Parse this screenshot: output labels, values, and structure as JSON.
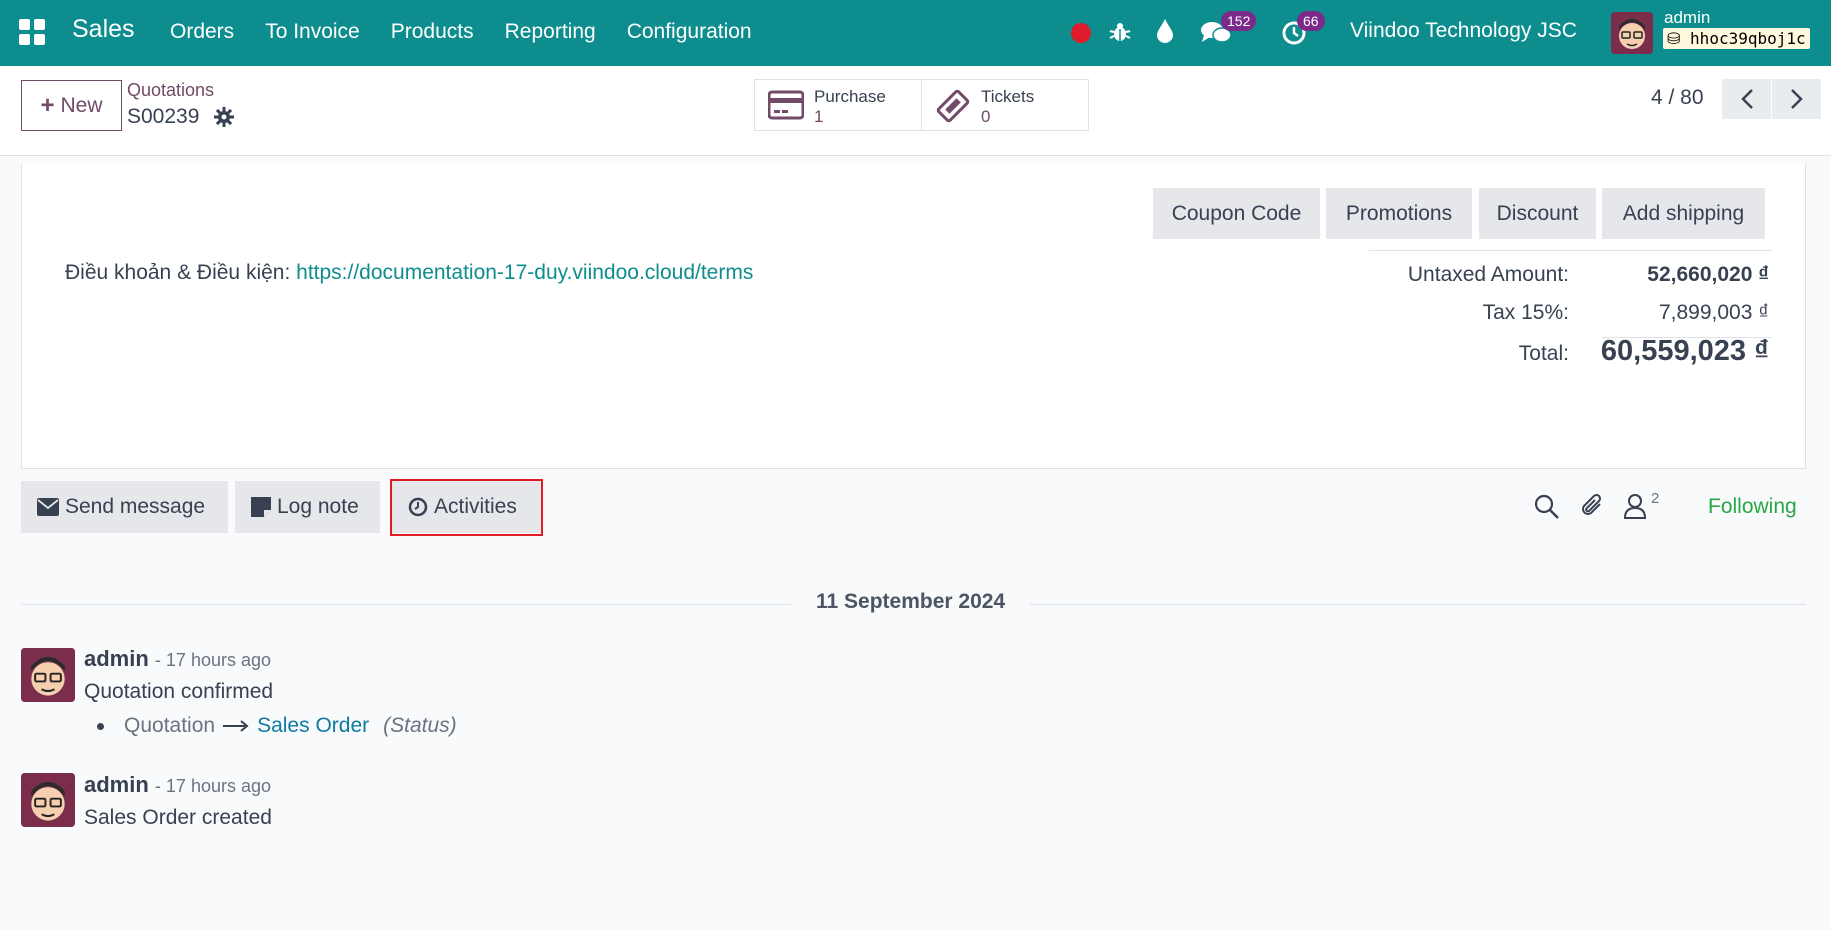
{
  "navbar": {
    "brand": "Sales",
    "menu": [
      "Orders",
      "To Invoice",
      "Products",
      "Reporting",
      "Configuration"
    ],
    "messages_count": "152",
    "activities_count": "66",
    "company": "Viindoo Technology JSC",
    "user": "admin",
    "database": "hhoc39qboj1c"
  },
  "control_panel": {
    "new_label": "New",
    "breadcrumb_parent": "Quotations",
    "breadcrumb_current": "S00239",
    "smart_buttons": [
      {
        "label": "Purchase",
        "value": "1"
      },
      {
        "label": "Tickets",
        "value": "0"
      }
    ],
    "pager": "4 / 80"
  },
  "form": {
    "buttons": [
      "Coupon Code",
      "Promotions",
      "Discount",
      "Add shipping"
    ],
    "terms_label": "Điều khoản & Điều kiện: ",
    "terms_link": "https://documentation-17-duy.viindoo.cloud/terms",
    "totals": {
      "untaxed_label": "Untaxed Amount:",
      "untaxed_value": "52,660,020 ₫",
      "tax_label": "Tax 15%:",
      "tax_value": "7,899,003 ₫",
      "total_label": "Total:",
      "total_value": "60,559,023 ₫"
    }
  },
  "chatter": {
    "send_message": "Send message",
    "log_note": "Log note",
    "activities": "Activities",
    "followers_count": "2",
    "following": "Following",
    "date": "11 September 2024",
    "messages": [
      {
        "author": "admin",
        "time": "- 17 hours ago",
        "body": "Quotation confirmed",
        "tracking": {
          "old": "Quotation",
          "new": "Sales Order",
          "field": "(Status)"
        }
      },
      {
        "author": "admin",
        "time": "- 17 hours ago",
        "body": "Sales Order created"
      }
    ]
  }
}
